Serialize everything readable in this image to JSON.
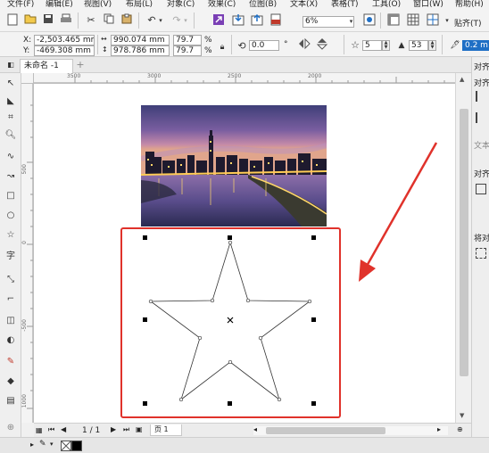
{
  "menubar": {
    "items": [
      "文件(F)",
      "编辑(E)",
      "视图(V)",
      "布局(L)",
      "对象(C)",
      "效果(C)",
      "位图(B)",
      "文本(X)",
      "表格(T)",
      "工具(O)",
      "窗口(W)",
      "帮助(H)"
    ]
  },
  "toolbar": {
    "zoom_value": "6%",
    "snap_label": "贴齐(T)"
  },
  "property_bar": {
    "x_label": "X:",
    "x_value": "-2,503.465 mm",
    "y_label": "Y:",
    "y_value": "-469.308 mm",
    "width_value": "990.074 mm",
    "height_value": "978.786 mm",
    "scale_x": "79.7",
    "scale_y": "79.7",
    "percent_x": "%",
    "percent_y": "%",
    "rotation_value": "0.0",
    "degree_symbol": "°",
    "points_value": "5",
    "sharpness_value": "53",
    "outline_width": "0.2 mm"
  },
  "document": {
    "tab_name": "未命名 -1"
  },
  "ruler": {
    "h_ticks": [
      "3500",
      "3000",
      "2500",
      "2000"
    ],
    "v_ticks": [
      "500",
      "0",
      "-500",
      "1000"
    ]
  },
  "right_panel": {
    "labels": [
      "对齐",
      "对齐",
      "文本",
      "对齐",
      "将对"
    ]
  },
  "status": {
    "page_counter": "1 / 1",
    "page_tab": "页 1"
  },
  "colors": {
    "selection_box": "#e0322b",
    "arrow": "#e0322b",
    "accent_blue": "#1f6fc5"
  }
}
